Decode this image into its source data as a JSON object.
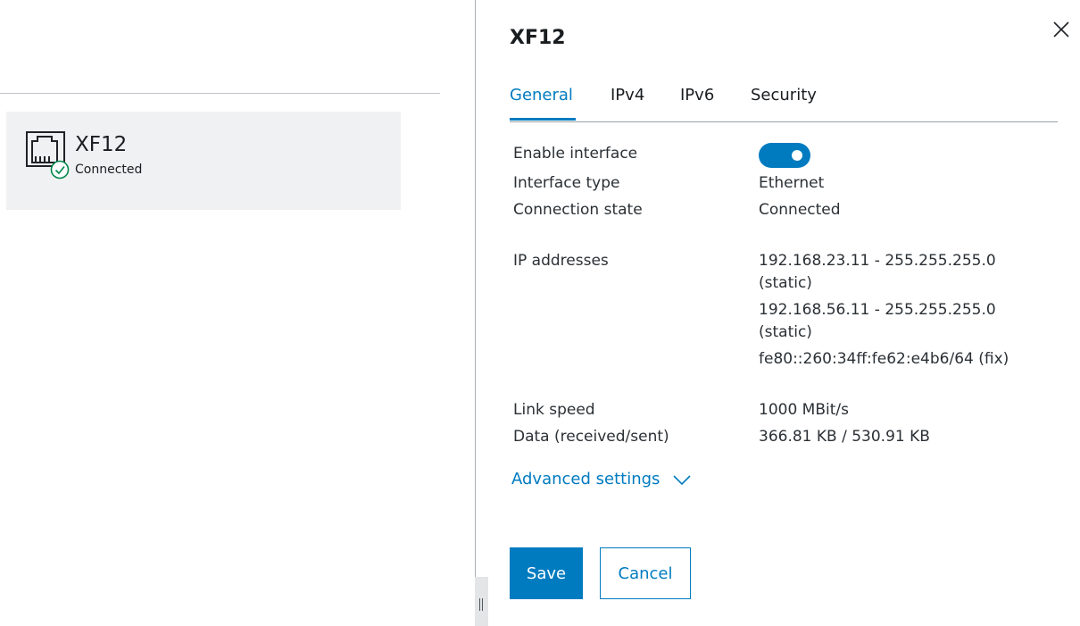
{
  "interface_list": {
    "items": [
      {
        "name": "XF12",
        "status": "Connected",
        "icon": "ethernet-port-icon",
        "status_icon": "check-circle-icon"
      }
    ]
  },
  "panel": {
    "title": "XF12",
    "close_icon": "close-icon",
    "tabs": [
      {
        "label": "General",
        "active": true
      },
      {
        "label": "IPv4",
        "active": false
      },
      {
        "label": "IPv6",
        "active": false
      },
      {
        "label": "Security",
        "active": false
      }
    ],
    "fields": {
      "enable_interface": {
        "label": "Enable interface",
        "value": true
      },
      "interface_type": {
        "label": "Interface type",
        "value": "Ethernet"
      },
      "connection_state": {
        "label": "Connection state",
        "value": "Connected"
      },
      "ip_addresses": {
        "label": "IP addresses",
        "values": [
          {
            "line1": "192.168.23.11 - 255.255.255.0",
            "line2": "(static)"
          },
          {
            "line1": "192.168.56.11 - 255.255.255.0",
            "line2": "(static)"
          },
          {
            "line1": "fe80::260:34ff:fe62:e4b6/64 (fix)"
          }
        ]
      },
      "link_speed": {
        "label": "Link speed",
        "value": "1000 MBit/s"
      },
      "data": {
        "label": "Data (received/sent)",
        "value": "366.81 KB / 530.91 KB"
      }
    },
    "advanced_settings": {
      "label": "Advanced settings",
      "icon": "chevron-down-icon"
    },
    "buttons": {
      "save": "Save",
      "cancel": "Cancel"
    }
  },
  "colors": {
    "accent": "#007bc0",
    "status_ok": "#00884a",
    "card_bg": "#eff1f2",
    "text": "#2b3035"
  }
}
